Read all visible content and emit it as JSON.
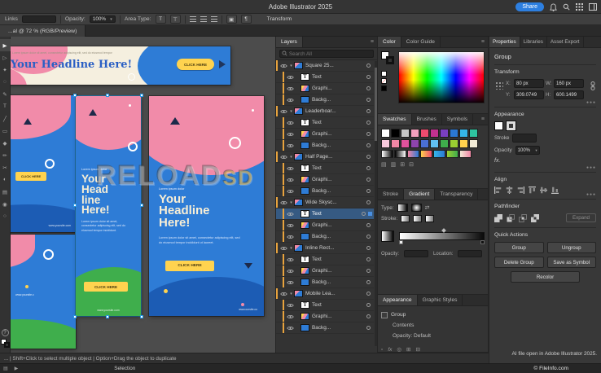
{
  "titlebar": {
    "title": "Adobe Illustrator 2025",
    "share_label": "Share"
  },
  "controlbar": {
    "links_label": "Links",
    "opacity_label": "Opacity:",
    "opacity_value": "100%",
    "area_type_label": "Area Type:",
    "transform_label": "Transform"
  },
  "doc_tab": {
    "title": "...al @ 72 % (RGB/Preview)"
  },
  "tools": [
    {
      "name": "selection-tool",
      "glyph": "▶"
    },
    {
      "name": "direct-selection-tool",
      "glyph": "▷"
    },
    {
      "name": "magic-wand-tool",
      "glyph": "✦"
    },
    {
      "name": "lasso-tool",
      "glyph": "◌"
    },
    {
      "name": "pen-tool",
      "glyph": "✎"
    },
    {
      "name": "type-tool",
      "glyph": "T"
    },
    {
      "name": "line-segment-tool",
      "glyph": "╱"
    },
    {
      "name": "rectangle-tool",
      "glyph": "▭"
    },
    {
      "name": "paintbrush-tool",
      "glyph": "◆"
    },
    {
      "name": "pencil-tool",
      "glyph": "✏"
    },
    {
      "name": "scissors-tool",
      "glyph": "✂"
    },
    {
      "name": "rotate-tool",
      "glyph": "◐"
    },
    {
      "name": "gradient-tool",
      "glyph": "▤"
    },
    {
      "name": "eyedropper-tool",
      "glyph": "◉"
    },
    {
      "name": "zoom-tool",
      "glyph": "○"
    }
  ],
  "canvas": {
    "watermark_main": "RELOAD",
    "watermark_accent": "SD",
    "leaderboard": {
      "kicker": "Lorem ipsum dolor sit amet, consectetur adipiscing elit, sed do eiusmod tempor",
      "headline": "Your Headline Here!",
      "cta": "CLICK HERE"
    },
    "skyscraper": {
      "kicker": "Lorem ipsum dolor",
      "headline_lines": [
        "Your",
        "Head",
        "line",
        "Here!"
      ],
      "body": "Lorem ipsum dolor sit amet, consectetur adipiscing elit, sed do eiusmod tempor incididunt.",
      "cta": "CLICK HERE",
      "url": "www.yoursite.com"
    },
    "halfpage": {
      "kicker": "Lorem ipsum dolor",
      "headline_lines": [
        "Your",
        "Headline",
        "Here!"
      ],
      "body": "Lorem ipsum dolor sit amet, consectetur adipiscing elit, sed do eiusmod tempor incididunt ut laoreet.",
      "cta": "CLICK HERE",
      "url": "www.oursite.co"
    },
    "partial_left_top": {
      "cta": "CLICK HERE",
      "url": "www.yoursite.com"
    },
    "partial_left_bottom": {
      "url": "www.yoursite.c"
    }
  },
  "layers_panel": {
    "tab_label": "Layers",
    "search_placeholder": "Search All",
    "rows": [
      {
        "label": "Square 25...",
        "type": "group"
      },
      {
        "label": "Text",
        "type": "text"
      },
      {
        "label": "Graphi...",
        "type": "graphic"
      },
      {
        "label": "Backg...",
        "type": "background"
      },
      {
        "label": "Leaderboar...",
        "type": "group"
      },
      {
        "label": "Text",
        "type": "text"
      },
      {
        "label": "Graphi...",
        "type": "graphic"
      },
      {
        "label": "Backg...",
        "type": "background"
      },
      {
        "label": "Half Page...",
        "type": "group"
      },
      {
        "label": "Text",
        "type": "text"
      },
      {
        "label": "Graphi...",
        "type": "graphic"
      },
      {
        "label": "Backg...",
        "type": "background"
      },
      {
        "label": "Wide Skysc...",
        "type": "group"
      },
      {
        "label": "Text",
        "type": "text",
        "selected": true
      },
      {
        "label": "Graphi...",
        "type": "graphic"
      },
      {
        "label": "Backg...",
        "type": "background"
      },
      {
        "label": "Inline Rect...",
        "type": "group"
      },
      {
        "label": "Text",
        "type": "text"
      },
      {
        "label": "Graphi...",
        "type": "graphic"
      },
      {
        "label": "Backg...",
        "type": "background"
      },
      {
        "label": "Mobile Lea...",
        "type": "group"
      },
      {
        "label": "Text",
        "type": "text"
      },
      {
        "label": "Graphi...",
        "type": "graphic"
      },
      {
        "label": "Backg...",
        "type": "background"
      }
    ]
  },
  "color_panel": {
    "tabs": [
      "Color",
      "Color Guide"
    ]
  },
  "swatches_panel": {
    "tabs": [
      "Swatches",
      "Brushes",
      "Symbols"
    ],
    "row1": [
      "#ffffff",
      "#000000",
      "#c8c8c8",
      "#f4a0bd",
      "#ef4b6e",
      "#c2318f",
      "#7a3fc1",
      "#2b78d4",
      "#35b5e8",
      "#2ec4a0"
    ],
    "row2": [
      "#f8c8dc",
      "#f287a5",
      "#e0529c",
      "#8e44ad",
      "#4a6fd4",
      "#61c0f2",
      "#3fae4c",
      "#9acd32",
      "#ffd24d",
      "#f3ecd8"
    ],
    "gradient_row": [
      [
        "#ffffff",
        "#000000"
      ],
      [
        "#000000",
        "#ffffff"
      ],
      [
        "#f287a5",
        "#2b78d4"
      ],
      [
        "#ffd24d",
        "#ef4b6e"
      ],
      [
        "#35b5e8",
        "#2b78d4"
      ],
      [
        "#9acd32",
        "#3fae4c"
      ],
      [
        "#f3ecd8",
        "#f287a5"
      ]
    ]
  },
  "gradient_panel": {
    "tabs": [
      "Stroke",
      "Gradient",
      "Transparency"
    ],
    "type_label": "Type:",
    "stroke_label": "Stroke:",
    "opacity_label": "Opacity:",
    "location_label": "Location:"
  },
  "appearance_panel": {
    "tabs": [
      "Appearance",
      "Graphic Styles"
    ],
    "row_group": "Group",
    "row_contents": "Contents",
    "row_opacity": "Opacity: Default"
  },
  "properties": {
    "tabs": [
      "Properties",
      "Libraries",
      "Asset Export"
    ],
    "selection_type": "Group",
    "transform": {
      "title": "Transform",
      "x_label": "X:",
      "x_value": "80 px",
      "y_label": "Y:",
      "y_value": "309.0749",
      "w_label": "W:",
      "w_value": "160 px",
      "h_label": "H:",
      "h_value": "600.1499"
    },
    "appearance": {
      "title": "Appearance",
      "stroke_label": "Stroke",
      "opacity_label": "Opacity",
      "opacity_value": "100%",
      "fx_label": "fx."
    },
    "align": {
      "title": "Align",
      "icons": [
        "align-left",
        "align-center-h",
        "align-right",
        "align-top",
        "align-middle",
        "align-bottom"
      ]
    },
    "pathfinder": {
      "title": "Pathfinder",
      "icons": [
        "unite",
        "minus-front",
        "intersect",
        "exclude"
      ],
      "expand_label": "Expand"
    },
    "quick_actions": {
      "title": "Quick Actions",
      "buttons": [
        "Group",
        "Ungroup",
        "Delete Group",
        "Save as Symbol",
        "Recolor"
      ]
    }
  },
  "statusbar": {
    "hint": "... | Shift+Click to select multiple object | Option+Drag the object to duplicate",
    "tool_label": "Selection",
    "note_line1": "AI file open in Adobe Illustrator 2025.",
    "note_line2": "© FileInfo.com"
  }
}
